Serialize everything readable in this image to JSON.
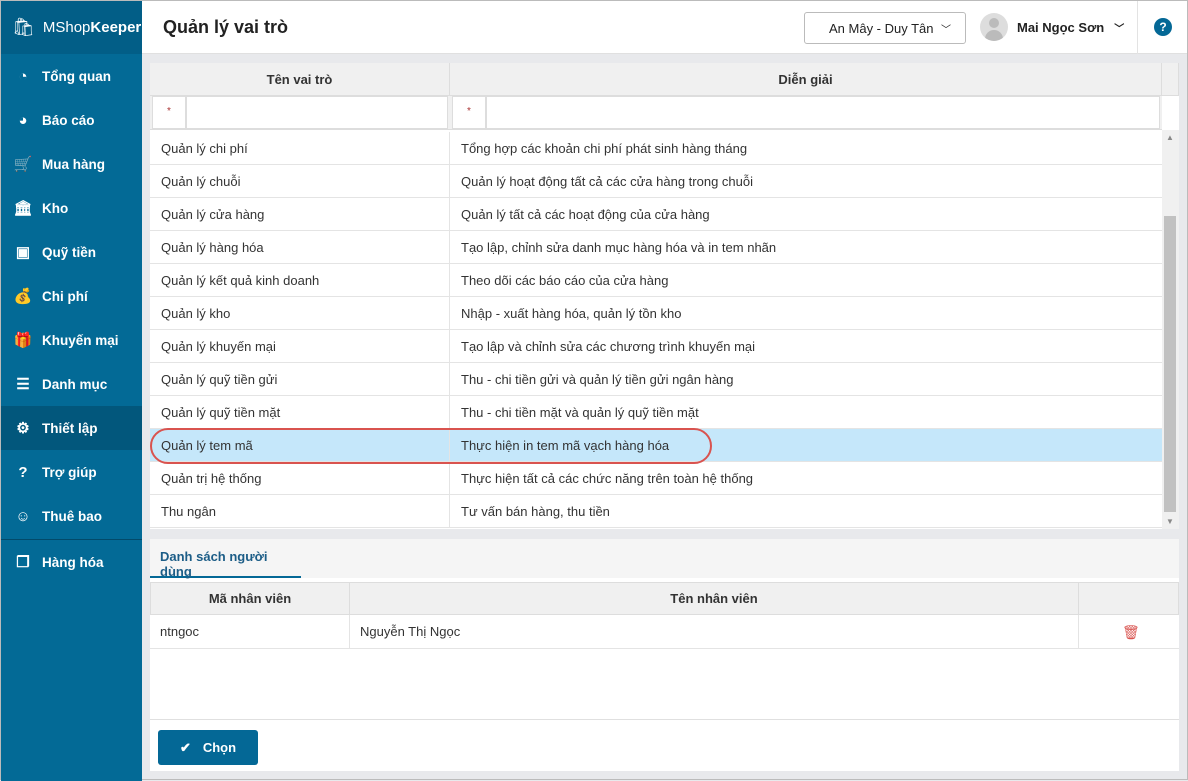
{
  "app": {
    "brand_light": "MShop",
    "brand_bold": "Keeper"
  },
  "sidebar": {
    "items": [
      {
        "label": "Tổng quan",
        "icon": "dashboard-icon"
      },
      {
        "label": "Báo cáo",
        "icon": "pie-chart-icon"
      },
      {
        "label": "Mua hàng",
        "icon": "cart-icon"
      },
      {
        "label": "Kho",
        "icon": "warehouse-icon"
      },
      {
        "label": "Quỹ tiền",
        "icon": "safe-icon"
      },
      {
        "label": "Chi phí",
        "icon": "money-bag-icon"
      },
      {
        "label": "Khuyến mại",
        "icon": "gift-icon"
      },
      {
        "label": "Danh mục",
        "icon": "list-icon"
      },
      {
        "label": "Thiết lập",
        "icon": "gear-icon",
        "active": true
      },
      {
        "label": "Trợ giúp",
        "icon": "help-icon"
      },
      {
        "label": "Thuê bao",
        "icon": "user-icon"
      },
      {
        "label": "Hàng hóa",
        "icon": "boxes-icon"
      }
    ]
  },
  "header": {
    "title": "Quản lý vai trò",
    "store": "An Mây - Duy Tân",
    "user": "Mai Ngọc Sơn",
    "help": "?"
  },
  "roles": {
    "columns": [
      "Tên vai trò",
      "Diễn giải"
    ],
    "filter_marker": "*",
    "rows": [
      [
        "Quản lý chi phí",
        "Tổng hợp các khoản chi phí phát sinh hàng tháng"
      ],
      [
        "Quản lý chuỗi",
        "Quản lý hoạt động tất cả các cửa hàng trong chuỗi"
      ],
      [
        "Quản lý cửa hàng",
        "Quản lý tất cả các hoạt động của cửa hàng"
      ],
      [
        "Quản lý hàng hóa",
        "Tạo lập, chỉnh sửa danh mục hàng hóa và in tem nhãn"
      ],
      [
        "Quản lý kết quả kinh doanh",
        "Theo dõi các báo cáo của cửa hàng"
      ],
      [
        "Quản lý kho",
        "Nhập - xuất hàng hóa, quản lý tồn kho"
      ],
      [
        "Quản lý khuyến mại",
        "Tạo lập và chỉnh sửa các chương trình khuyến mại"
      ],
      [
        "Quản lý quỹ tiền gửi",
        "Thu - chi tiền gửi và quản lý tiền gửi ngân hàng"
      ],
      [
        "Quản lý quỹ tiền mặt",
        "Thu - chi tiền mặt và quản lý quỹ tiền mặt"
      ],
      [
        "Quản lý tem mã",
        "Thực hiện in tem mã vạch hàng hóa"
      ],
      [
        "Quản trị hệ thống",
        "Thực hiện tất cả các chức năng trên toàn hệ thống"
      ],
      [
        "Thu ngân",
        "Tư vấn bán hàng, thu tiền"
      ]
    ],
    "selected_index": 9
  },
  "users": {
    "tab": "Danh sách người dùng",
    "columns": [
      "Mã nhân viên",
      "Tên nhân viên"
    ],
    "rows": [
      [
        "ntngoc",
        "Nguyễn Thị Ngọc"
      ]
    ]
  },
  "footer": {
    "choose_label": "Chọn"
  },
  "colors": {
    "sidebar": "#036a96",
    "accent": "#046896",
    "selected_row": "#c5e7fa",
    "highlight_ring": "#d9534f"
  }
}
